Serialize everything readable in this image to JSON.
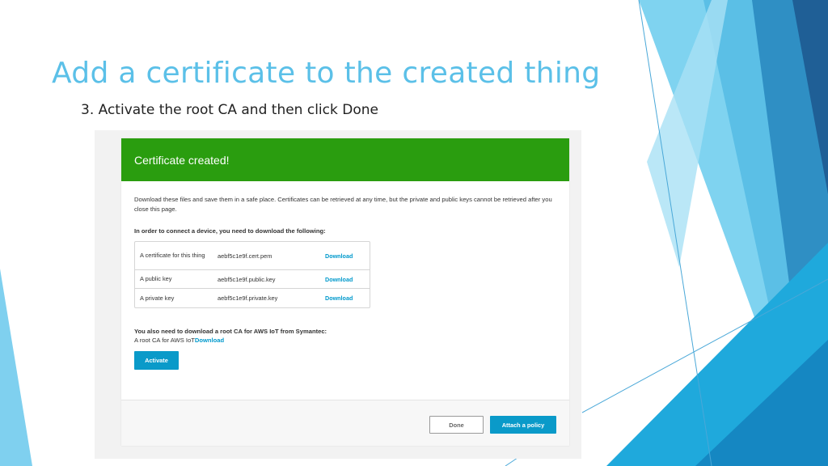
{
  "slide": {
    "title": "Add a certificate to the created thing",
    "subtitle": "3. Activate the root CA and then click Done"
  },
  "dialog": {
    "header": "Certificate created!",
    "intro": "Download these files and save them in a safe place. Certificates can be retrieved at any time, but the private and public keys cannot be retrieved after you close this page.",
    "instruction": "In order to connect a device, you need to download the following:",
    "files": [
      {
        "label": "A certificate for this thing",
        "file": "aebf5c1e9f.cert.pem",
        "link": "Download"
      },
      {
        "label": "A public key",
        "file": "aebf5c1e9f.public.key",
        "link": "Download"
      },
      {
        "label": "A private key",
        "file": "aebf5c1e9f.private.key",
        "link": "Download"
      }
    ],
    "root_ca_heading": "You also need to download a root CA for AWS IoT from Symantec:",
    "root_ca_text": "A root CA for AWS IoT",
    "root_ca_link": "Download",
    "activate_label": "Activate",
    "done_label": "Done",
    "attach_policy_label": "Attach a policy"
  },
  "colors": {
    "title": "#5bc0e8",
    "header_green": "#2a9d0f",
    "accent_blue": "#0a9ac9",
    "link_blue": "#0099cc"
  }
}
